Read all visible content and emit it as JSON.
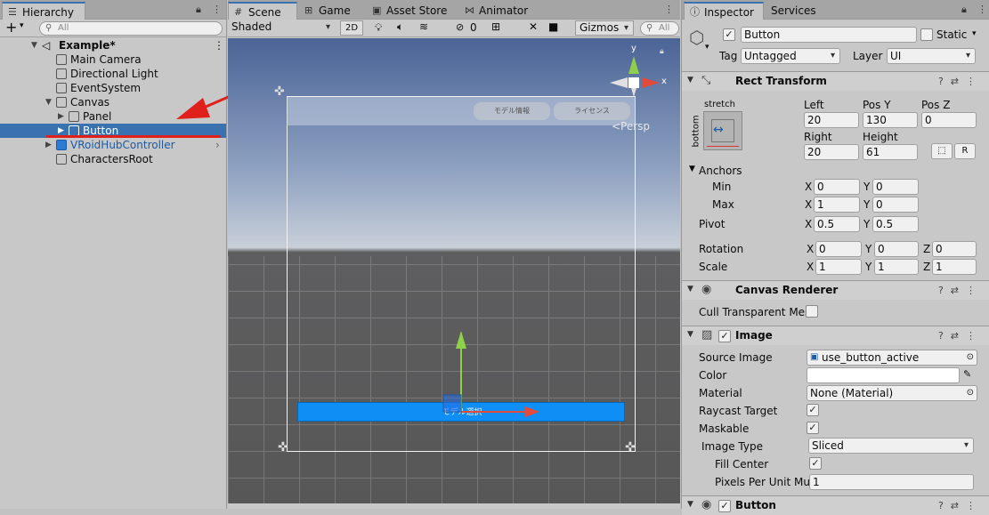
{
  "hierarchy": {
    "tab": "Hierarchy",
    "search_placeholder": "All",
    "add_label": "+",
    "items": [
      {
        "label": "Example*",
        "level": 0,
        "expanded": true,
        "bold": true,
        "type": "scene"
      },
      {
        "label": "Main Camera",
        "level": 1,
        "type": "object"
      },
      {
        "label": "Directional Light",
        "level": 1,
        "type": "object"
      },
      {
        "label": "EventSystem",
        "level": 1,
        "type": "object"
      },
      {
        "label": "Canvas",
        "level": 1,
        "expanded": true,
        "type": "object"
      },
      {
        "label": "Panel",
        "level": 2,
        "collapsed": true,
        "type": "object"
      },
      {
        "label": "Button",
        "level": 2,
        "collapsed": true,
        "selected": true,
        "type": "object"
      },
      {
        "label": "VRoidHubController",
        "level": 1,
        "collapsed": true,
        "prefab": true,
        "type": "prefab"
      },
      {
        "label": "CharactersRoot",
        "level": 1,
        "type": "object"
      }
    ]
  },
  "scene": {
    "tabs": [
      "Scene",
      "Game",
      "Asset Store",
      "Animator"
    ],
    "shading": "Shaded",
    "mode_2d": "2D",
    "hidden_count": "0",
    "gizmos": "Gizmos",
    "search_placeholder": "All",
    "persp_label": "<Persp",
    "axis_y": "y",
    "axis_x": "x",
    "ui_tab_model_info": "モデル情報",
    "ui_tab_license": "ライセンス",
    "ui_button_select": "モデル選択"
  },
  "inspector": {
    "tabs": [
      "Inspector",
      "Services"
    ],
    "object_name": "Button",
    "static_label": "Static",
    "tag_label": "Tag",
    "tag_value": "Untagged",
    "layer_label": "Layer",
    "layer_value": "UI",
    "rect_transform": {
      "title": "Rect Transform",
      "anchor_preset_h": "stretch",
      "anchor_preset_v": "bottom",
      "left_label": "Left",
      "left": "20",
      "posy_label": "Pos Y",
      "posy": "130",
      "posz_label": "Pos Z",
      "posz": "0",
      "right_label": "Right",
      "right": "20",
      "height_label": "Height",
      "height": "61",
      "r_button": "R",
      "anchors_label": "Anchors",
      "min_label": "Min",
      "min_x": "0",
      "min_y": "0",
      "max_label": "Max",
      "max_x": "1",
      "max_y": "0",
      "pivot_label": "Pivot",
      "pivot_x": "0.5",
      "pivot_y": "0.5",
      "rotation_label": "Rotation",
      "rot_x": "0",
      "rot_y": "0",
      "rot_z": "0",
      "scale_label": "Scale",
      "scale_x": "1",
      "scale_y": "1",
      "scale_z": "1"
    },
    "canvas_renderer": {
      "title": "Canvas Renderer",
      "cull_label": "Cull Transparent Mes"
    },
    "image": {
      "title": "Image",
      "source_label": "Source Image",
      "source_value": "use_button_active",
      "color_label": "Color",
      "material_label": "Material",
      "material_value": "None (Material)",
      "raycast_label": "Raycast Target",
      "maskable_label": "Maskable",
      "image_type_label": "Image Type",
      "image_type_value": "Sliced",
      "fill_center_label": "Fill Center",
      "ppu_label": "Pixels Per Unit Mul",
      "ppu_value": "1"
    },
    "button_component": {
      "title": "Button"
    }
  },
  "colors": {
    "selection": "#3a72b0",
    "prefab_text": "#1c5aa5",
    "ui_button": "#0f8ff5",
    "annotation_red": "#e0201a"
  }
}
